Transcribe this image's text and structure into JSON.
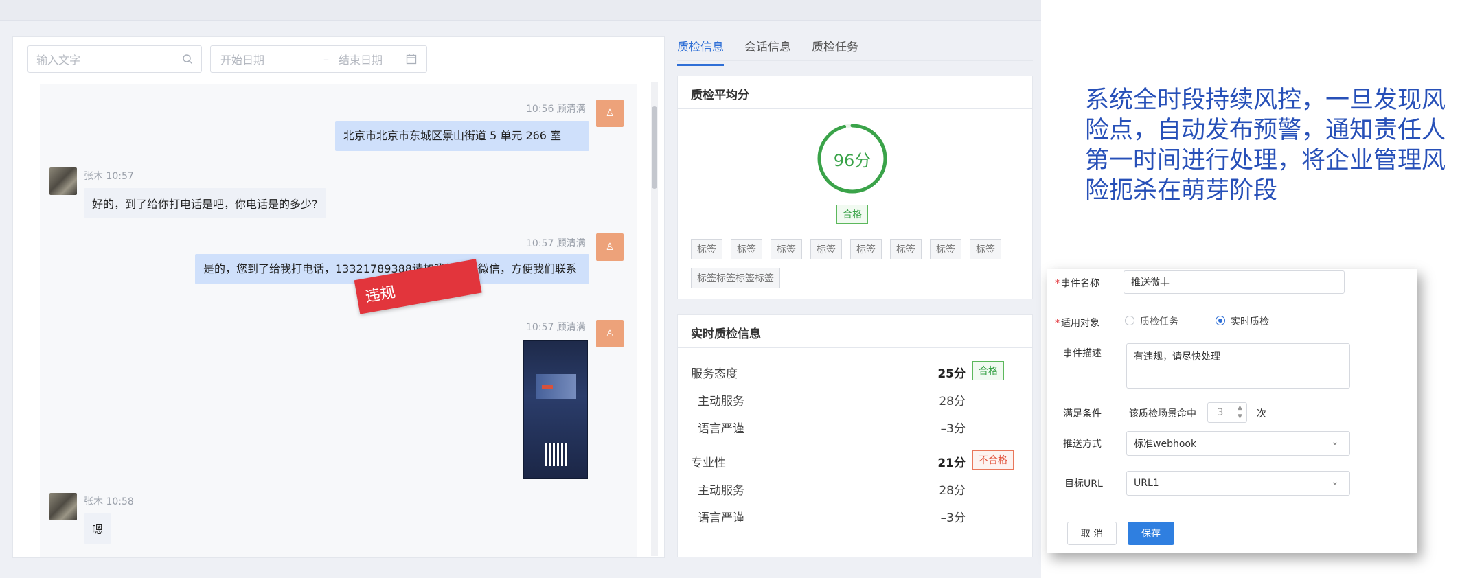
{
  "search": {
    "placeholder": "输入文字"
  },
  "date_range": {
    "start": "开始日期",
    "sep": "–",
    "end": "结束日期"
  },
  "messages": [
    {
      "meta": "10:56  顾清满",
      "text": "北京市北京市东城区景山街道 5 单元 266 室"
    },
    {
      "meta": "张木  10:57",
      "text": "好的，到了给你打电话是吧，你电话是的多少?"
    },
    {
      "meta": "10:57  顾清满",
      "text": "是的，您到了给我打电话，13321789388请加我的私人微信，方便我们联系"
    },
    {
      "meta": "10:57  顾清满",
      "text": ""
    },
    {
      "meta": "张木  10:58",
      "text": "嗯"
    }
  ],
  "violation_label": "违规",
  "tabs": [
    "质检信息",
    "会话信息",
    "质检任务"
  ],
  "avg_card": {
    "title": "质检平均分",
    "score": "96分",
    "score_value": 96,
    "status": "合格"
  },
  "tags": [
    "标签",
    "标签",
    "标签",
    "标签",
    "标签",
    "标签",
    "标签",
    "标签",
    "标签标签标签标签"
  ],
  "realtime": {
    "title": "实时质检信息",
    "groups": [
      {
        "name": "服务态度",
        "score": "25分",
        "status": "合格",
        "status_type": "pass",
        "items": [
          {
            "name": "主动服务",
            "score": "28分"
          },
          {
            "name": "语言严谨",
            "score": "–3分"
          }
        ]
      },
      {
        "name": "专业性",
        "score": "21分",
        "status": "不合格",
        "status_type": "fail",
        "items": [
          {
            "name": "主动服务",
            "score": "28分"
          },
          {
            "name": "语言严谨",
            "score": "–3分"
          }
        ]
      }
    ]
  },
  "promo_text": "系统全时段持续风控，一旦发现风险点，自动发布预警，通知责任人第一时间进行处理，将企业管理风险扼杀在萌芽阶段",
  "form": {
    "event_name_label": "事件名称",
    "event_name_value": "推送微丰",
    "target_label": "适用对象",
    "target_options": [
      "质检任务",
      "实时质检"
    ],
    "target_selected": "实时质检",
    "desc_label": "事件描述",
    "desc_value": "有违规，请尽快处理",
    "condition_label": "满足条件",
    "condition_prefix": "该质检场景命中",
    "condition_count": "3",
    "condition_suffix": "次",
    "push_label": "推送方式",
    "push_value": "标准webhook",
    "url_label": "目标URL",
    "url_value": "URL1",
    "cancel_label": "取 消",
    "save_label": "保存",
    "required_mark": "*"
  },
  "colors": {
    "accent": "#2f6fd6",
    "pass": "#3aa349",
    "fail": "#e2533b",
    "violation": "#e2353c",
    "promo": "#2750b8"
  }
}
